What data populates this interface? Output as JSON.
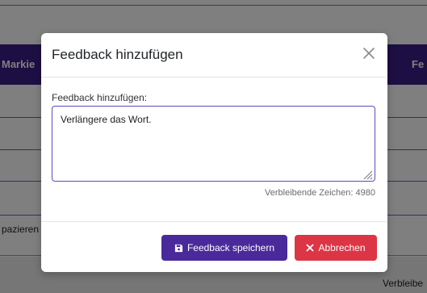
{
  "background": {
    "header_left": "Markie",
    "header_right": "Fe",
    "row_text": "pazieren",
    "bottom_text": "Verbleibe"
  },
  "modal": {
    "title": "Feedback hinzufügen",
    "close_icon": "close-icon",
    "field_label": "Feedback hinzufügen:",
    "textarea_value": "Verlängere das Wort.",
    "counter": "Verbleibende Zeichen: 4980",
    "save_label": "Feedback speichern",
    "save_icon": "floppy-disk-icon",
    "cancel_label": "Abbrechen",
    "cancel_icon": "x-icon"
  },
  "colors": {
    "primary": "#4a2a9b",
    "danger": "#dc3545",
    "header_bg": "#3b1f87",
    "textarea_border": "#5a4bc5"
  }
}
